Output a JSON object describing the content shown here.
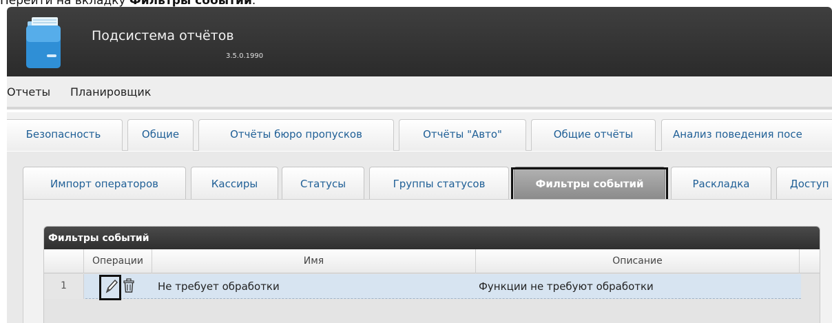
{
  "instruction": {
    "prefix": "Перейти на вкладку ",
    "target": "Фильтры событий",
    "suffix": "."
  },
  "header": {
    "title": "Подсистема отчётов",
    "version": "3.5.0.1990"
  },
  "menu": [
    "Отчеты",
    "Планировщик"
  ],
  "tabs_level1": [
    "Безопасность",
    "Общие",
    "Отчёты бюро пропусков",
    "Отчёты \"Авто\"",
    "Общие отчёты",
    "Анализ поведения посе"
  ],
  "tabs_level2": [
    "Импорт операторов",
    "Кассиры",
    "Статусы",
    "Группы статусов",
    "Фильтры событий",
    "Раскладка",
    "Доступ"
  ],
  "active_tab_level2": "Фильтры событий",
  "grid": {
    "title": "Фильтры событий",
    "columns": [
      "Операции",
      "Имя",
      "Описание"
    ],
    "rows": [
      {
        "num": "1",
        "name": "Не требует обработки",
        "description": "Функции не требуют обработки"
      }
    ]
  },
  "icons": {
    "edit": "pencil-icon",
    "delete": "trash-icon"
  },
  "colors": {
    "header_bg": "#333333",
    "tab_text": "#1f5f96",
    "active_tab_bg": "#9e9e9e",
    "row_selected": "#d7e4f1"
  }
}
